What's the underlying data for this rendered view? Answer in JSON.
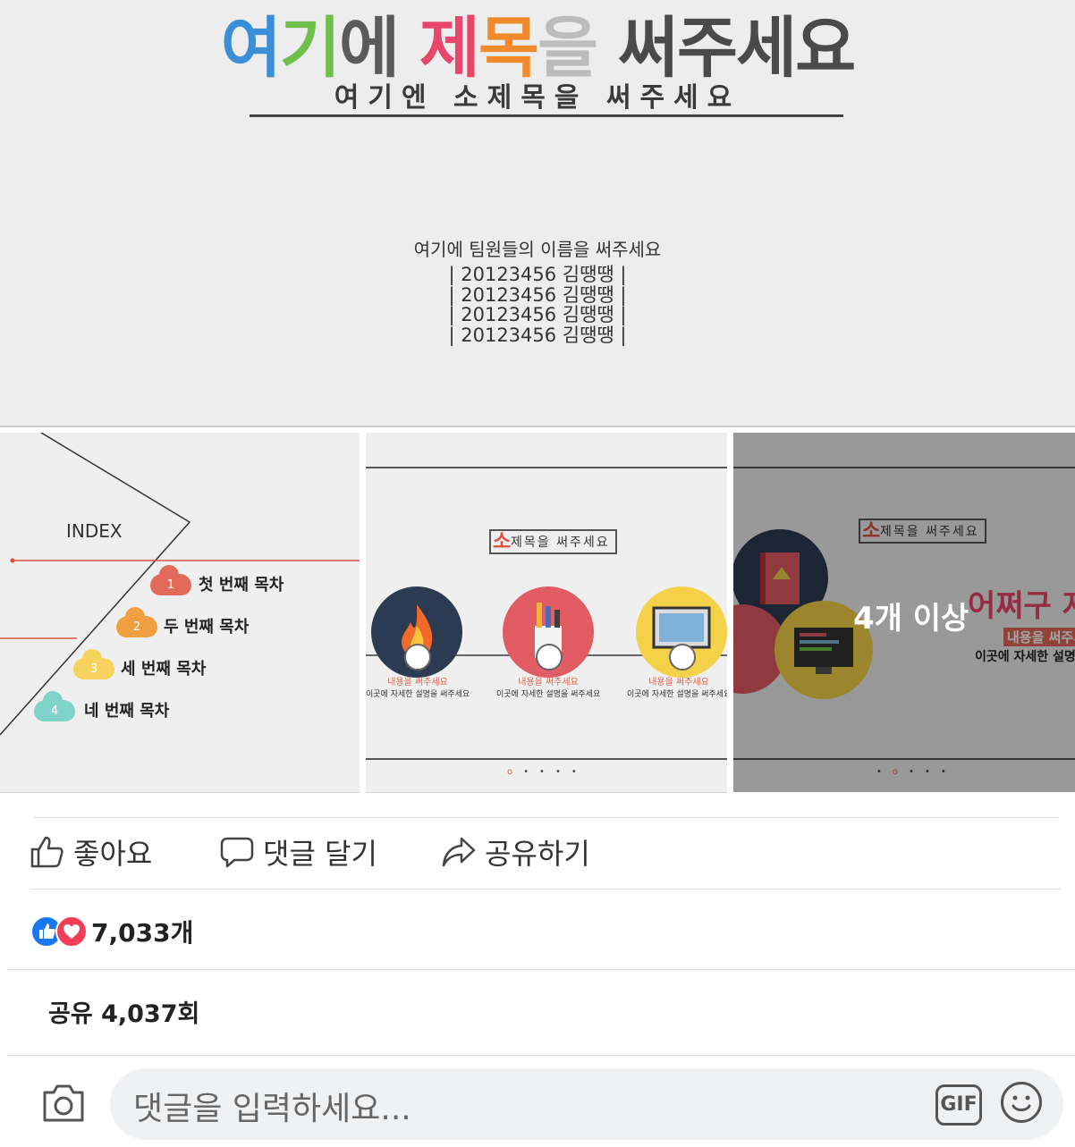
{
  "main_slide": {
    "title_chars": [
      {
        "t": "여",
        "c": "#3a8fd6"
      },
      {
        "t": "기",
        "c": "#6ec04a"
      },
      {
        "t": "에 ",
        "c": "#5b5b5b"
      },
      {
        "t": "제",
        "c": "#e8476b"
      },
      {
        "t": "목",
        "c": "#f08a2c"
      },
      {
        "t": "을 ",
        "c": "#bcbcbc"
      },
      {
        "t": "써주세요",
        "c": "#4a4a4a"
      }
    ],
    "subtitle": "여기엔 소제목을 써주세요",
    "members_title": "여기에 팀원들의 이름을 써주세요",
    "members": [
      "| 20123456 김땡땡 |",
      "| 20123456 김땡땡 |",
      "| 20123456 김땡땡 |",
      "| 20123456 김땡땡 |"
    ]
  },
  "thumb_index": {
    "label": "INDEX",
    "items": [
      {
        "num": "1",
        "label": "첫 번째 목차",
        "color": "#e26a5a"
      },
      {
        "num": "2",
        "label": "두 번째 목차",
        "color": "#f0a040"
      },
      {
        "num": "3",
        "label": "세 번째 목차",
        "color": "#f6d35e"
      },
      {
        "num": "4",
        "label": "네 번째 목차",
        "color": "#7fd3c9"
      }
    ]
  },
  "thumb_content": {
    "so": "소",
    "subtitle": "제목을 써주세요",
    "cards": [
      {
        "title": "내용을 써주세요",
        "desc": "이곳에 자세한 설명을 써주세요",
        "bg": "#2d3b52"
      },
      {
        "title": "내용을 써주세요",
        "desc": "이곳에 자세한 설명을 써주세요",
        "bg": "#e25c63"
      },
      {
        "title": "내용을 써주세요",
        "desc": "이곳에 자세한 설명을 써주세요",
        "bg": "#f3d24a"
      }
    ],
    "dots": [
      "o",
      "•",
      "•",
      "•",
      "•"
    ]
  },
  "thumb_more": {
    "so": "소",
    "subtitle": "제목을 써주세요",
    "big_text": "어쩌구 저",
    "red_text": "내용을 써주세",
    "desc": "이곳에 자세한 설명을",
    "more_label": "4개 이상",
    "dots": [
      "•",
      "o",
      "•",
      "•",
      "•"
    ]
  },
  "actions": {
    "like": "좋아요",
    "comment": "댓글 달기",
    "share": "공유하기"
  },
  "reactions": {
    "count": "7,033개",
    "like_color": "#1877f2",
    "love_color": "#f33e58"
  },
  "shares": "공유 4,037회",
  "comment_input": {
    "placeholder": "댓글을 입력하세요...",
    "gif": "GIF"
  }
}
